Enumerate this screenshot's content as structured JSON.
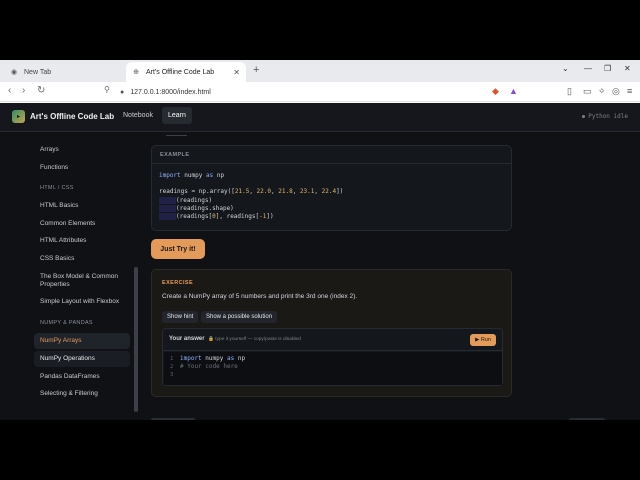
{
  "browser": {
    "tabs": [
      {
        "title": "New Tab"
      },
      {
        "title": "Art's Offline Code Lab"
      }
    ],
    "url": "127.0.0.1:8000/index.html"
  },
  "app": {
    "brand": "Art's Offline Code Lab",
    "nav": [
      "Notebook",
      "Learn"
    ],
    "status": "Python idle"
  },
  "sidebar": {
    "items_top": [
      "Arrays",
      "Functions"
    ],
    "section_html": "HTML / CSS",
    "items_html": [
      "HTML Basics",
      "Common Elements",
      "HTML Attributes",
      "CSS Basics",
      "The Box Model & Common Properties",
      "Simple Layout with Flexbox"
    ],
    "section_numpy": "NUMPY & PANDAS",
    "items_numpy": [
      "NumPy Arrays",
      "NumPy Operations",
      "Pandas DataFrames",
      "Selecting & Filtering"
    ]
  },
  "example": {
    "label": "EXAMPLE",
    "button": "Just Try it!"
  },
  "exercise": {
    "label": "EXERCISE",
    "prompt": "Create a NumPy array of 5 numbers and print the 3rd one (index 2).",
    "show_hint": "Show hint",
    "show_solution": "Show a possible solution",
    "answer_label": "Your answer",
    "answer_hint": "🔒 type it yourself — copy/paste is disabled",
    "run": "▶ Run",
    "line_numbers": "1\n2\n3",
    "starter_line1": "import numpy as np",
    "starter_line2": "# Your code here"
  },
  "colors": {
    "accent": "#e49b59",
    "background": "#0f1115"
  }
}
